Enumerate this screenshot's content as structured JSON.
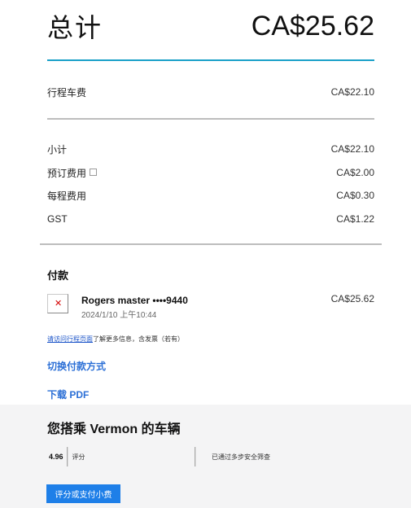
{
  "summary": {
    "total_label": "总计",
    "total_amount": "CA$25.62"
  },
  "fare": {
    "label": "行程车费",
    "amount": "CA$22.10"
  },
  "breakdown": [
    {
      "label": "小计",
      "amount": "CA$22.10"
    },
    {
      "label": "预订费用",
      "amount": "CA$2.00"
    },
    {
      "label": "每程费用",
      "amount": "CA$0.30"
    },
    {
      "label": "GST",
      "amount": "CA$1.22"
    }
  ],
  "payment": {
    "section_title": "付款",
    "card_name": "Rogers master ••••9440",
    "date_time": "2024/1/10 上午10:44",
    "amount": "CA$25.62"
  },
  "note": {
    "link_text": "请访问行程页面",
    "suffix": "了解更多信息，含发票（若有）"
  },
  "actions": {
    "switch_payment": "切换付款方式",
    "download_pdf": "下载 PDF"
  },
  "driver": {
    "title": "您搭乘 Vermon 的车辆",
    "rating_value": "4.96",
    "rating_label": "评分",
    "safety_label": "已通过多步安全筛查",
    "rate_button": "评分或支付小费"
  },
  "colors": {
    "accent_teal": "#1aa0c8",
    "link_blue": "#2b6fd6",
    "button_blue": "#1e7fe8"
  }
}
